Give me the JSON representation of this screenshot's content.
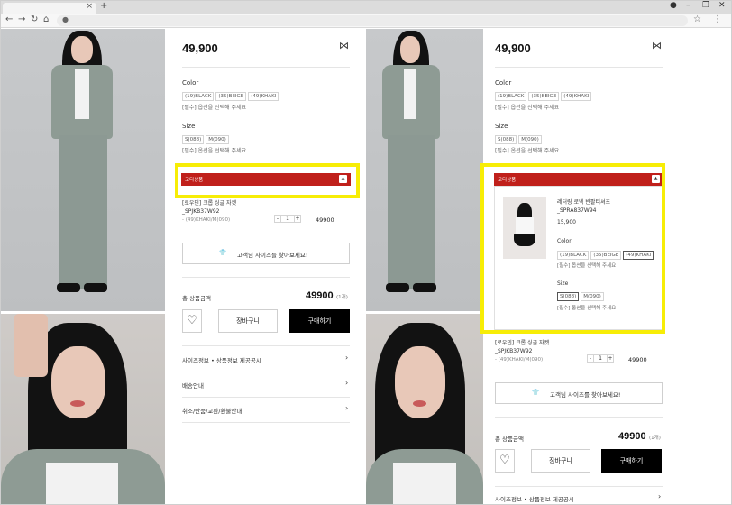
{
  "browser": {
    "tab_close": "×",
    "new_tab": "+",
    "nav": {
      "back": "←",
      "forward": "→",
      "reload": "↻",
      "home": "⌂"
    },
    "lock": "●",
    "star": "☆",
    "account": "⋮",
    "window": {
      "record": "●",
      "minimize": "–",
      "restore": "❐",
      "close": "✕"
    }
  },
  "left": {
    "price": "49,900",
    "share_icon": "share-icon",
    "color_label": "Color",
    "colors": [
      "(19)BLACK",
      "(35)BEIGE",
      "(49)KHAKI"
    ],
    "color_note": "[필수] 옵션을 선택해 주세요",
    "size_label": "Size",
    "sizes": [
      "S(088)",
      "M(090)"
    ],
    "size_note": "[필수] 옵션을 선택해 주세요",
    "coordi_label": "코디상품",
    "coordi_toggle": "▲",
    "item_name_1": "[로우민] 크롭 싱글 자켓",
    "item_name_2": "_SPJKB37W92",
    "item_color": "- (49)KHAKI/M(090)",
    "qty": "1",
    "minus": "-",
    "plus": "+",
    "item_price": "49900",
    "size_finder": "고객님 사이즈를 찾아보세요!",
    "total_label": "총 상품금액",
    "total": "49900",
    "total_count": "(1개)",
    "wish_icon": "♡",
    "cart": "장바구니",
    "buy": "구매하기",
    "menus": [
      "사이즈정보 • 상품정보 제공공시",
      "배송안내",
      "취소/반품/교환/환불안내"
    ],
    "chevron": "›"
  },
  "right": {
    "price": "49,900",
    "color_label": "Color",
    "colors": [
      "(19)BLACK",
      "(35)BEIGE",
      "(49)KHAKI"
    ],
    "color_note": "[필수] 옵션을 선택해 주세요",
    "size_label": "Size",
    "sizes": [
      "S(088)",
      "M(090)"
    ],
    "size_note": "[필수] 옵션을 선택해 주세요",
    "coordi_label": "코디상품",
    "coordi_toggle": "▲",
    "coordi_item": {
      "name_1": "레터링 로넥 반팔티셔츠",
      "name_2": "_SPRA837W94",
      "price": "15,900",
      "color_label": "Color",
      "colors": [
        "(19)BLACK",
        "(35)BEIGE",
        "(49)KHAKI"
      ],
      "color_note": "[필수] 옵션을 선택해 주세요",
      "size_label": "Size",
      "sizes": [
        "S(088)",
        "M(090)"
      ],
      "size_note": "[필수] 옵션을 선택해 주세요"
    },
    "item_name_1": "[로우민] 크롭 싱글 자켓",
    "item_name_2": "_SPJKB37W92",
    "item_color": "- (49)KHAKI/M(090)",
    "qty": "1",
    "minus": "-",
    "plus": "+",
    "item_price": "49900",
    "size_finder": "고객님 사이즈를 찾아보세요!",
    "total_label": "총 상품금액",
    "total": "49900",
    "total_count": "(1개)",
    "wish_icon": "♡",
    "cart": "장바구니",
    "buy": "구매하기",
    "menus": [
      "사이즈정보 • 상품정보 제공공시"
    ],
    "chevron": "›"
  },
  "colors": {
    "highlight": "#f7ed06",
    "coordi_bar": "#c0201b",
    "buy_button": "#000000"
  }
}
